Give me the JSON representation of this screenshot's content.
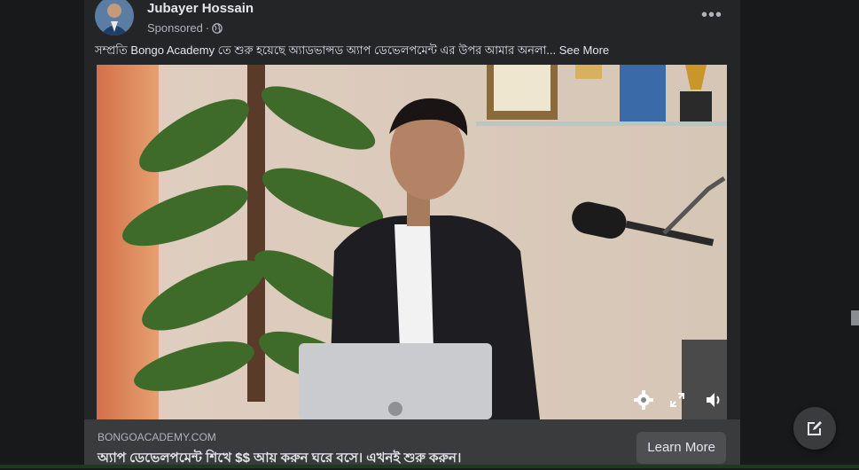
{
  "post": {
    "author": "Jubayer Hossain",
    "sponsored": "Sponsored",
    "privacy_icon": "globe-icon",
    "caption": "সম্প্রতি Bongo Academy তে শুরু হয়েছে অ্যাডভান্সড অ্যাপ ডেভেলপমেন্ট এর উপর আমার অনলা...",
    "see_more": "See More"
  },
  "link_preview": {
    "domain": "BONGOACADEMY.COM",
    "headline": "অ্যাপ ডেভেলপমেন্ট শিখে $$ আয় করুন ঘরে বসে। এখনই শুরু করুন।",
    "cta": "Learn More"
  },
  "video_controls": [
    "gear-icon",
    "fullscreen-icon",
    "volume-icon"
  ],
  "colors": {
    "card": "#242526",
    "page": "#18191a",
    "link_bar": "#3a3b3c",
    "button": "#4e4f50"
  }
}
